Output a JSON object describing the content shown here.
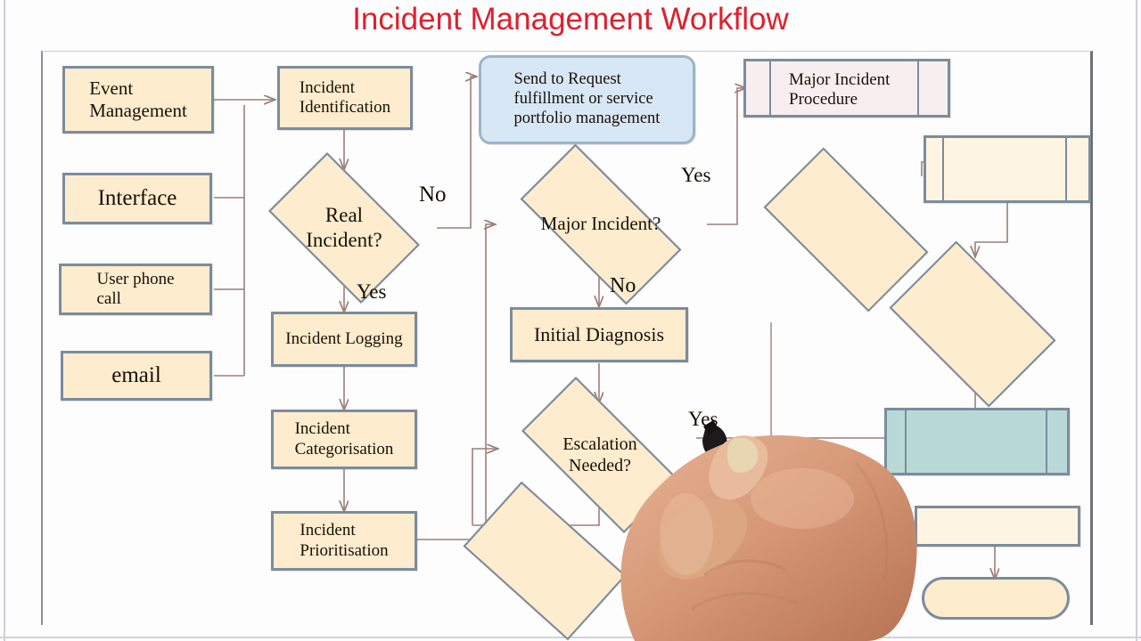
{
  "title": "Incident Management Workflow",
  "title_color": "#e01f2d",
  "palette": {
    "node_fill": "#fdeccd",
    "node_border": "#7b8c9c",
    "request_box_fill": "#d8e7f5",
    "major_box_fill": "#f7eef0",
    "teal_fill": "#b9d9d6",
    "connector": "#9c8079",
    "canvas": "#ffffff"
  },
  "nodes": {
    "event_management": {
      "label": "Event\nManagement",
      "shape": "box"
    },
    "interface": {
      "label": "Interface",
      "shape": "box"
    },
    "user_phone_call": {
      "label": "User phone\ncall",
      "shape": "box"
    },
    "email": {
      "label": "email",
      "shape": "box"
    },
    "incident_identification": {
      "label": "Incident\nIdentification",
      "shape": "box"
    },
    "real_incident": {
      "label": "Real\nIncident?",
      "shape": "diamond"
    },
    "incident_logging": {
      "label": "Incident Logging",
      "shape": "box"
    },
    "incident_categorisation": {
      "label": "Incident\nCategorisation",
      "shape": "box"
    },
    "incident_prioritisation": {
      "label": "Incident\nPrioritisation",
      "shape": "box"
    },
    "send_to_request_fulfillment": {
      "label": "Send to Request\nfulfillment or service\nportfolio management",
      "shape": "rounded-box"
    },
    "major_incident": {
      "label": "Major Incident?",
      "shape": "diamond"
    },
    "major_incident_procedure": {
      "label": "Major Incident\nProcedure",
      "shape": "box"
    },
    "initial_diagnosis": {
      "label": "Initial Diagnosis",
      "shape": "box"
    },
    "escalation_needed": {
      "label": "Escalation\nNeeded?",
      "shape": "diamond"
    },
    "unlabeled_diamond_bottom_center": {
      "label": "",
      "shape": "diamond"
    },
    "unlabeled_diamond_right_upper": {
      "label": "",
      "shape": "diamond"
    },
    "unlabeled_diamond_right_lower": {
      "label": "",
      "shape": "diamond"
    },
    "unlabeled_box_right_top": {
      "label": "",
      "shape": "box"
    },
    "unlabeled_box_teal": {
      "label": "",
      "shape": "box"
    },
    "unlabeled_box_right_bottom": {
      "label": "",
      "shape": "box"
    },
    "unlabeled_pill_right_bottom": {
      "label": "",
      "shape": "pill"
    }
  },
  "edge_labels": {
    "real_incident_no": "No",
    "real_incident_yes": "Yes",
    "major_incident_yes": "Yes",
    "major_incident_no": "No",
    "escalation_yes": "Yes"
  },
  "overlay": {
    "hand": "drawing-hand",
    "marker": "whiteboard-marker",
    "marker_body_color": "#b9c6cf",
    "marker_tip_color": "#1b1b1b",
    "skin_color": "#d8a182"
  }
}
